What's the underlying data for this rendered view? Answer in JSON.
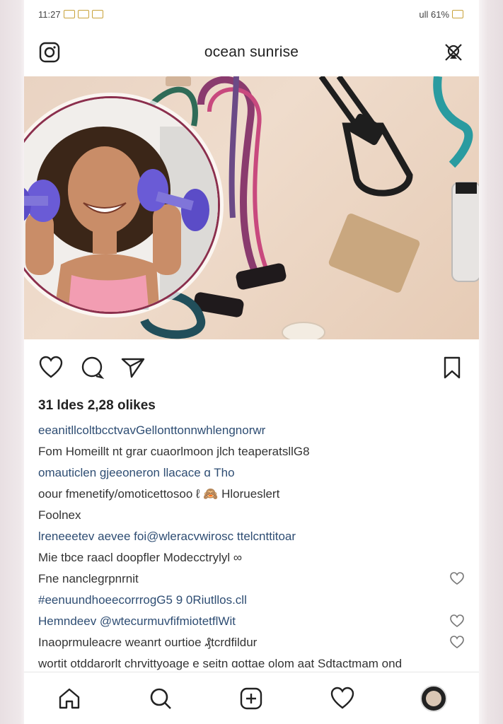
{
  "status_bar": {
    "left_text": "11:27",
    "right_text": "ull 61%"
  },
  "header": {
    "title": "ocean sunrise"
  },
  "post": {
    "likes_text": "31 ldes 2,28 olikes",
    "caption_lines": [
      {
        "style": "link",
        "text": "eeanitllcoltbcctvavGellonttonnwhlengnorwr"
      },
      {
        "style": "text",
        "text": "Fom Homeillt nt  ɡrar cuaorlmoon jlch teaperatsllG8"
      },
      {
        "style": "link",
        "text": "omauticlen ɡjeeoneron llacace ɑ Tho"
      },
      {
        "style": "text",
        "text": "oour  fmenetify/omoticettosoo ℓ 🙈 Hlorueslert"
      },
      {
        "style": "text",
        "text": "Foolnex"
      },
      {
        "style": "link",
        "text": "lreneeetev aevee foi@wleracvwirosc ttelcnttitoar"
      },
      {
        "style": "text",
        "text": "Mie tbce  raacl doopfler Modecctrylyl ∞"
      },
      {
        "style": "text",
        "text": "Fne nanclegrpnrnit"
      },
      {
        "style": "link",
        "text": "#eenuundhoeecorrrogG5 9 0Riutllos.cll"
      },
      {
        "style": "link",
        "text": "Hemndeev @wtecurmuvfifmiotetflWit"
      },
      {
        "style": "text",
        "text": "Inaoprmuleacre weanrt ourtioe  ₰tcrdfildur"
      },
      {
        "style": "text",
        "text": "wortit otddarorlt chrvittyoage e seitn ɑottae  olom aat  Sdtactmam ond"
      }
    ]
  },
  "icons": {
    "camera": "camera-icon",
    "direct": "direct-message-icon",
    "like": "heart-icon",
    "comment": "comment-icon",
    "share": "share-icon",
    "save": "bookmark-icon",
    "home": "home-icon",
    "search": "search-icon",
    "add": "add-post-icon",
    "activity": "heart-icon"
  },
  "colors": {
    "link": "#2e4d73",
    "avatar_ring": "#8b2f4d"
  }
}
